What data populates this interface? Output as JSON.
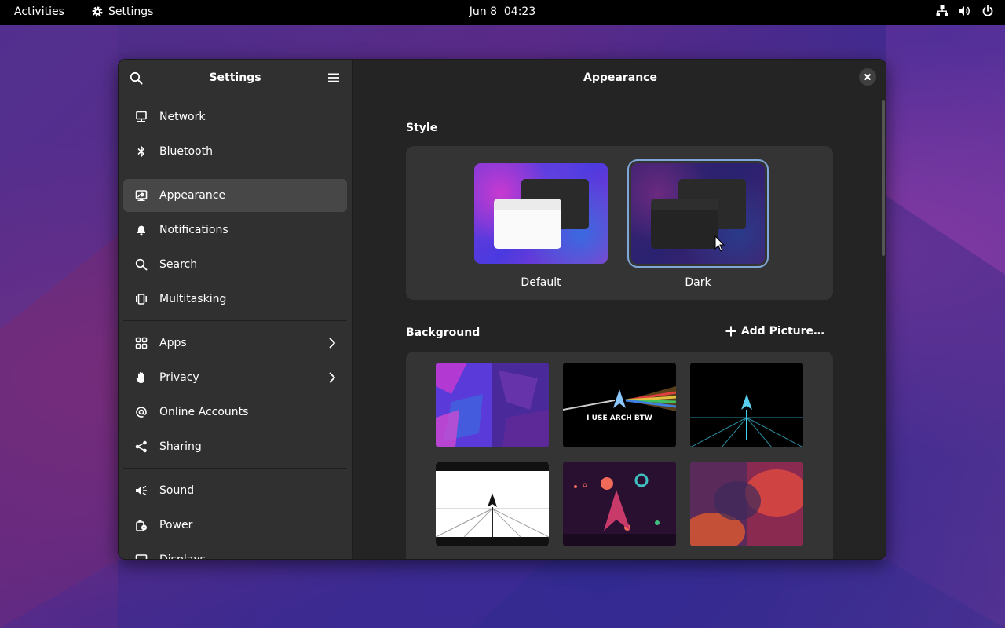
{
  "topbar": {
    "activities": "Activities",
    "app_name": "Settings",
    "clock": "Jun 8  04:23"
  },
  "sidebar": {
    "title": "Settings",
    "items": [
      {
        "label": "Network",
        "icon": "network-icon"
      },
      {
        "label": "Bluetooth",
        "icon": "bluetooth-icon"
      },
      {
        "label": "Appearance",
        "icon": "appearance-icon",
        "active": true
      },
      {
        "label": "Notifications",
        "icon": "bell-icon"
      },
      {
        "label": "Search",
        "icon": "search-icon"
      },
      {
        "label": "Multitasking",
        "icon": "multitasking-icon"
      },
      {
        "label": "Apps",
        "icon": "apps-icon"
      },
      {
        "label": "Privacy",
        "icon": "hand-icon"
      },
      {
        "label": "Online Accounts",
        "icon": "at-icon"
      },
      {
        "label": "Sharing",
        "icon": "share-icon"
      },
      {
        "label": "Sound",
        "icon": "speaker-icon"
      },
      {
        "label": "Power",
        "icon": "power-plug-icon"
      },
      {
        "label": "Displays",
        "icon": "display-icon"
      }
    ]
  },
  "content": {
    "title": "Appearance",
    "style_section": "Style",
    "style_options": [
      {
        "label": "Default"
      },
      {
        "label": "Dark",
        "selected": true
      }
    ],
    "background_section": "Background",
    "add_picture": "Add Picture…",
    "wallpaper_text": "I USE ARCH BTW"
  },
  "colors": {
    "accent": "#7fa7d9",
    "window_bg": "#242424",
    "sidebar_bg": "#303030",
    "card_bg": "#343434"
  }
}
